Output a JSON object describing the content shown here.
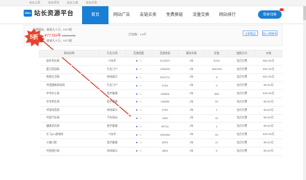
{
  "topbar": {
    "links": [
      "站长之家",
      "站长资讯",
      "站长工具",
      "站长问答"
    ]
  },
  "header": {
    "logo_badge": "28co",
    "logo_text": "站长资源平台",
    "nav": [
      "首页",
      "网站广告",
      "友链买卖",
      "免费换链",
      "流量交换",
      "网站排行"
    ],
    "active_index": 0,
    "login_label": "登录/注册"
  },
  "promo": {
    "line1": "正规网站，收录几十万，DOT权",
    "price_label": "原始价：",
    "price": "¥77.50/年",
    "old_price": "¥155.00/年",
    "line3": "正规网站，收录几十万，DOT权",
    "site_label": "打包购：1.6千",
    "btn1": "立即购买",
    "btn2": "加入购物车"
  },
  "badge": {
    "text": "5折"
  },
  "table": {
    "headers": [
      "网站名称",
      "行业分类",
      "百度权重",
      "百度收录",
      "建站年限",
      "反链",
      "链接方式",
      "价格"
    ],
    "rows": [
      [
        "软件资讯网",
        "IT技术",
        "1",
        "2213097",
        "1年",
        "8100",
        "包月付费",
        "¥30.00/月"
      ],
      [
        "爱日家园网",
        "行业门户",
        "1",
        "1284052",
        "1年",
        "1840000",
        "包月付费",
        "¥25.00/月"
      ],
      [
        "热搜生活网",
        "休闲娱乐",
        "1",
        "2914711",
        "1年",
        "8",
        "包月付费",
        "¥20.00/月"
      ],
      [
        "中国建筑网站网",
        "行业门户",
        "1",
        "5794",
        "1年",
        "5",
        "包月付费",
        "¥5.00/月"
      ],
      [
        "中华护士网",
        "医疗健康",
        "1",
        "154894",
        "2年",
        "865",
        "包月付费",
        "¥15.00/月"
      ],
      [
        "中华养生网",
        "医疗健康",
        "1",
        "140655",
        "1年",
        "53",
        "包月付费",
        "¥5.00/月"
      ],
      [
        "中国电竞网",
        "休闲娱乐",
        "1",
        "5765",
        "1年",
        "2",
        "包月付费",
        "¥5.00/月"
      ],
      [
        "中国汽车网",
        "汽车网站",
        "1",
        "1069",
        "1年",
        "20",
        "包月付费",
        "¥5.00/月"
      ],
      [
        "健康资讯网",
        "医疗健康",
        "1",
        "59724",
        "1年",
        "1",
        "包月付费",
        "¥5.00/月"
      ],
      [
        "乐飞pro游戏网",
        "IT技术",
        "1",
        "1009084",
        "1年",
        "45",
        "包月付费",
        "¥15.00/月"
      ],
      [
        "七福口腔",
        "医疗健康",
        "1",
        "8293",
        "1年",
        "11",
        "包月付费",
        "¥5.00/月"
      ],
      [
        "中国旅行网",
        "休闲娱乐",
        "1",
        "4864",
        "1年",
        "6",
        "包月付费",
        "¥5.00/月"
      ]
    ]
  }
}
